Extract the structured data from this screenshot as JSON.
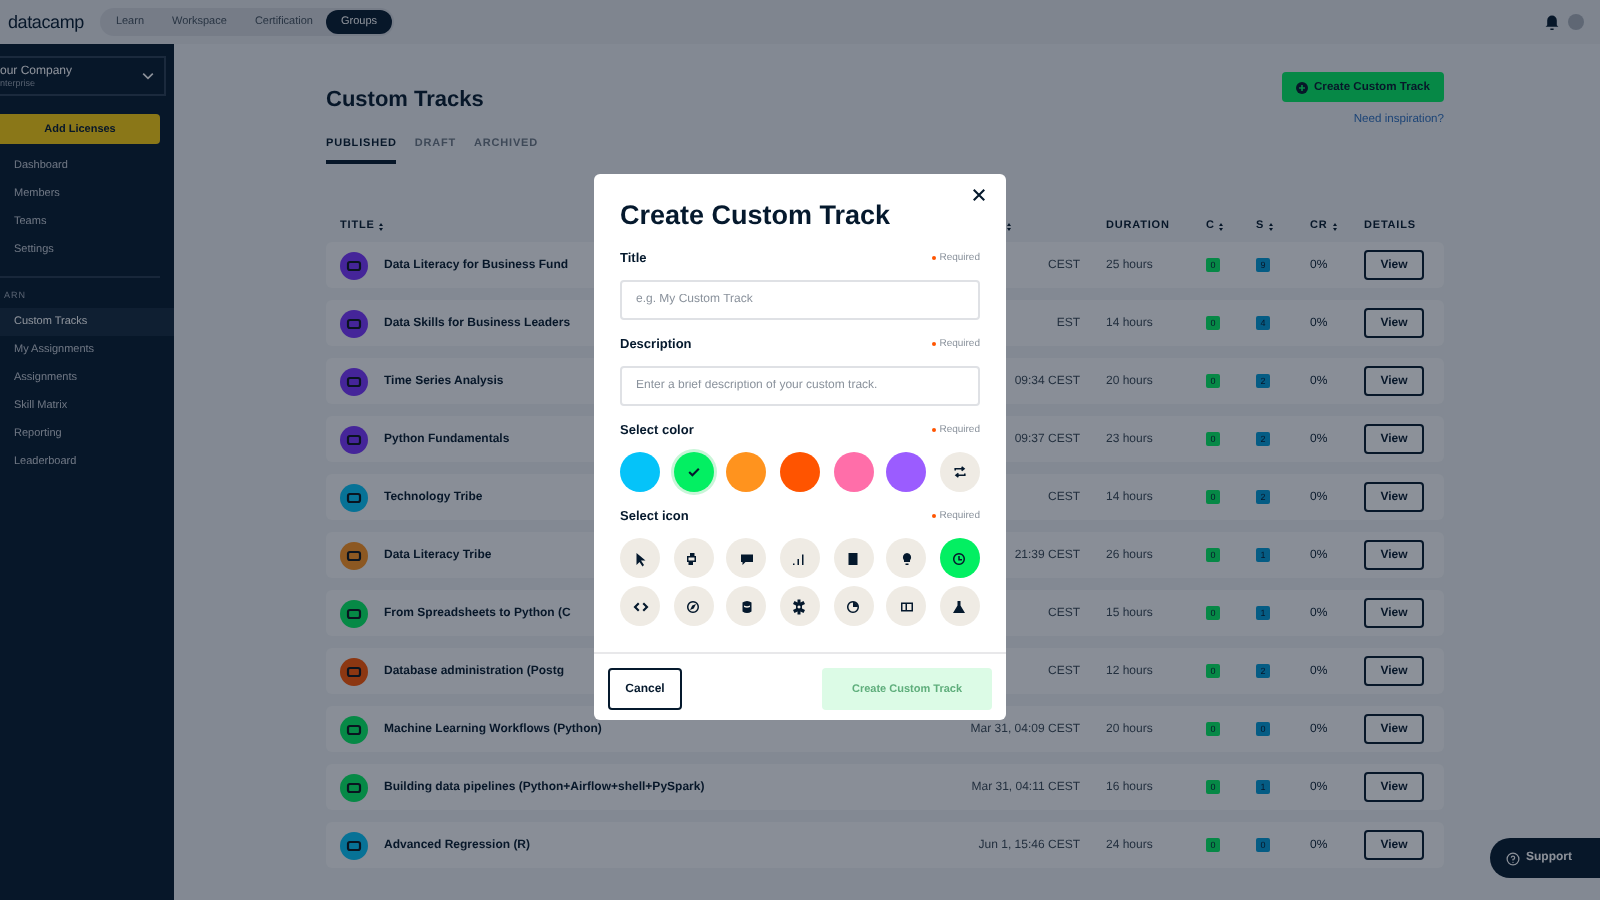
{
  "top_nav": {
    "logo": "datacamp",
    "tabs": [
      {
        "label": "Learn",
        "selected": false
      },
      {
        "label": "Workspace",
        "selected": false
      },
      {
        "label": "Certification",
        "selected": false
      },
      {
        "label": "Groups",
        "selected": true
      }
    ]
  },
  "sidebar": {
    "account": {
      "name": "our Company",
      "plan": "nterprise"
    },
    "add_licenses": "Add Licenses",
    "admin_items": [
      {
        "label": "Dashboard",
        "selected": false
      },
      {
        "label": "Members",
        "selected": false
      },
      {
        "label": "Teams",
        "selected": false
      },
      {
        "label": "Settings",
        "selected": false
      }
    ],
    "section_label": "ARN",
    "learn_items": [
      {
        "label": "Custom Tracks",
        "selected": true
      },
      {
        "label": "My Assignments",
        "selected": false
      },
      {
        "label": "Assignments",
        "selected": false
      },
      {
        "label": "Skill Matrix",
        "selected": false
      },
      {
        "label": "Reporting",
        "selected": false
      },
      {
        "label": "Leaderboard",
        "selected": false
      }
    ]
  },
  "page": {
    "title": "Custom Tracks",
    "create_button": "Create Custom Track",
    "inspiration_link": "Need inspiration?",
    "tabs": [
      {
        "label": "PUBLISHED",
        "selected": true
      },
      {
        "label": "DRAFT",
        "selected": false
      },
      {
        "label": "ARCHIVED",
        "selected": false
      }
    ]
  },
  "table": {
    "columns": [
      {
        "label": "TITLE",
        "sortable": true
      },
      {
        "sortable": true
      },
      {
        "label": "DURATION"
      },
      {
        "label": "C",
        "sortable": true
      },
      {
        "label": "S",
        "sortable": true
      },
      {
        "label": "CR",
        "sortable": true
      },
      {
        "label": "DETAILS"
      }
    ],
    "rows": [
      {
        "color": "#452599",
        "title": "Data Literacy for Business Fund",
        "date": "CEST",
        "duration": "25 hours",
        "c": "0",
        "s": "9",
        "cr": "0%",
        "action": "View"
      },
      {
        "color": "#452599",
        "title": "Data Skills for Business Leaders",
        "date": "EST",
        "duration": "14 hours",
        "c": "0",
        "s": "4",
        "cr": "0%",
        "action": "View"
      },
      {
        "color": "#452599",
        "title": "Time Series Analysis",
        "date": "09:34 CEST",
        "duration": "20 hours",
        "c": "0",
        "s": "2",
        "cr": "0%",
        "action": "View"
      },
      {
        "color": "#452599",
        "title": "Python Fundamentals",
        "date": "09:37 CEST",
        "duration": "23 hours",
        "c": "0",
        "s": "2",
        "cr": "0%",
        "action": "View"
      },
      {
        "color": "#077296",
        "title": "Technology Tribe",
        "date": "CEST",
        "duration": "14 hours",
        "c": "0",
        "s": "2",
        "cr": "0%",
        "action": "View"
      },
      {
        "color": "#8c5822",
        "title": "Data Literacy Tribe",
        "date": "21:39 CEST",
        "duration": "26 hours",
        "c": "0",
        "s": "1",
        "cr": "0%",
        "action": "View"
      },
      {
        "color": "#068946",
        "title": "From Spreadsheets to Python (C",
        "date": "CEST",
        "duration": "15 hours",
        "c": "0",
        "s": "1",
        "cr": "0%",
        "action": "View"
      },
      {
        "color": "#8c3712",
        "title": "Database administration (Postg",
        "date": "CEST",
        "duration": "12 hours",
        "c": "0",
        "s": "2",
        "cr": "0%",
        "action": "View"
      },
      {
        "color": "#068946",
        "title": "Machine Learning Workflows (Python)",
        "date": "Mar 31, 04:09 CEST",
        "duration": "20 hours",
        "c": "0",
        "s": "0",
        "cr": "0%",
        "action": "View"
      },
      {
        "color": "#068946",
        "title": "Building data pipelines (Python+Airflow+shell+PySpark)",
        "date": "Mar 31, 04:11 CEST",
        "duration": "16 hours",
        "c": "0",
        "s": "1",
        "cr": "0%",
        "action": "View"
      },
      {
        "color": "#077296",
        "title": "Advanced Regression (R)",
        "date": "Jun 1, 15:46 CEST",
        "duration": "24 hours",
        "c": "0",
        "s": "0",
        "cr": "0%",
        "action": "View"
      }
    ]
  },
  "modal": {
    "title": "Create Custom Track",
    "title_field": {
      "label": "Title",
      "required": "Required",
      "placeholder": "e.g. My Custom Track"
    },
    "description_field": {
      "label": "Description",
      "required": "Required",
      "placeholder": "Enter a brief description of your custom track."
    },
    "color_label": "Select color",
    "color_required": "Required",
    "colors": [
      {
        "color": "#05c3f9",
        "selected": false
      },
      {
        "color": "#03ef62",
        "selected": true
      },
      {
        "color": "#ff931e",
        "selected": false
      },
      {
        "color": "#ff5400",
        "selected": false
      },
      {
        "color": "#ff6ea9",
        "selected": false
      },
      {
        "color": "#9b5cff",
        "selected": false
      }
    ],
    "icon_label": "Select icon",
    "icon_required": "Required",
    "icons": [
      {
        "selected": false
      },
      {
        "selected": false
      },
      {
        "selected": false
      },
      {
        "selected": false
      },
      {
        "selected": false
      },
      {
        "selected": false
      },
      {
        "selected": true
      },
      {
        "selected": false
      },
      {
        "selected": false
      },
      {
        "selected": false
      },
      {
        "selected": false
      },
      {
        "selected": false
      },
      {
        "selected": false
      },
      {
        "selected": false
      }
    ],
    "cancel_button": "Cancel",
    "create_button": {
      "label": "Create Custom Track",
      "disabled": true
    }
  },
  "support_button": "Support"
}
